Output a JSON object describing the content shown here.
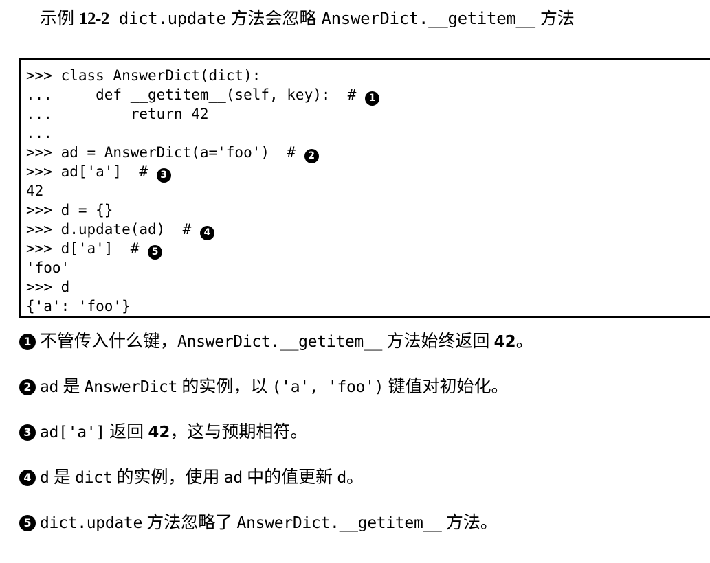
{
  "caption": {
    "label_cn": "示例",
    "number": "12-2",
    "code_1": "dict.update",
    "text_1": "方法会忽略",
    "code_2": "AnswerDict.__getitem__",
    "text_2": "方法"
  },
  "code_block": {
    "lines": [
      {
        "id": "line-1",
        "text": ">>> class AnswerDict(dict):",
        "marker": ""
      },
      {
        "id": "line-2",
        "text": "...     def __getitem__(self, key):  # ",
        "marker": "1"
      },
      {
        "id": "line-3",
        "text": "...         return 42",
        "marker": ""
      },
      {
        "id": "line-4",
        "text": "...",
        "marker": ""
      },
      {
        "id": "line-5",
        "text": ">>> ad = AnswerDict(a='foo')  # ",
        "marker": "2"
      },
      {
        "id": "line-6",
        "text": ">>> ad['a']  # ",
        "marker": "3"
      },
      {
        "id": "line-7",
        "text": "42",
        "marker": ""
      },
      {
        "id": "line-8",
        "text": ">>> d = {}",
        "marker": ""
      },
      {
        "id": "line-9",
        "text": ">>> d.update(ad)  # ",
        "marker": "4"
      },
      {
        "id": "line-10",
        "text": ">>> d['a']  # ",
        "marker": "5"
      },
      {
        "id": "line-11",
        "text": "'foo'",
        "marker": ""
      },
      {
        "id": "line-12",
        "text": ">>> d",
        "marker": ""
      },
      {
        "id": "line-13",
        "text": "{'a': 'foo'}",
        "marker": ""
      }
    ]
  },
  "notes": [
    {
      "marker": "1",
      "parts": [
        {
          "kind": "cn",
          "text": "不管传入什么键，"
        },
        {
          "kind": "mono",
          "text": "AnswerDict.__getitem__"
        },
        {
          "kind": "cn",
          "text": " 方法始终返回 "
        },
        {
          "kind": "num",
          "text": "42"
        },
        {
          "kind": "cn",
          "text": "。"
        }
      ]
    },
    {
      "marker": "2",
      "parts": [
        {
          "kind": "mono",
          "text": "ad"
        },
        {
          "kind": "cn",
          "text": " 是 "
        },
        {
          "kind": "mono",
          "text": "AnswerDict"
        },
        {
          "kind": "cn",
          "text": " 的实例，以 "
        },
        {
          "kind": "mono",
          "text": "('a', 'foo')"
        },
        {
          "kind": "cn",
          "text": " 键值对初始化。"
        }
      ]
    },
    {
      "marker": "3",
      "parts": [
        {
          "kind": "mono",
          "text": "ad['a']"
        },
        {
          "kind": "cn",
          "text": " 返回 "
        },
        {
          "kind": "num",
          "text": "42"
        },
        {
          "kind": "cn",
          "text": "，这与预期相符。"
        }
      ]
    },
    {
      "marker": "4",
      "parts": [
        {
          "kind": "mono",
          "text": "d"
        },
        {
          "kind": "cn",
          "text": " 是 "
        },
        {
          "kind": "mono",
          "text": "dict"
        },
        {
          "kind": "cn",
          "text": " 的实例，使用 "
        },
        {
          "kind": "mono",
          "text": "ad"
        },
        {
          "kind": "cn",
          "text": " 中的值更新 "
        },
        {
          "kind": "mono",
          "text": "d"
        },
        {
          "kind": "cn",
          "text": "。"
        }
      ]
    },
    {
      "marker": "5",
      "parts": [
        {
          "kind": "mono",
          "text": "dict.update"
        },
        {
          "kind": "cn",
          "text": " 方法忽略了 "
        },
        {
          "kind": "mono",
          "text": "AnswerDict.__getitem__"
        },
        {
          "kind": "cn",
          "text": " 方法。"
        }
      ]
    }
  ],
  "colors": {
    "text": "#000000",
    "background": "#ffffff",
    "border": "#000000",
    "marker_fill": "#000000",
    "marker_text": "#ffffff"
  }
}
